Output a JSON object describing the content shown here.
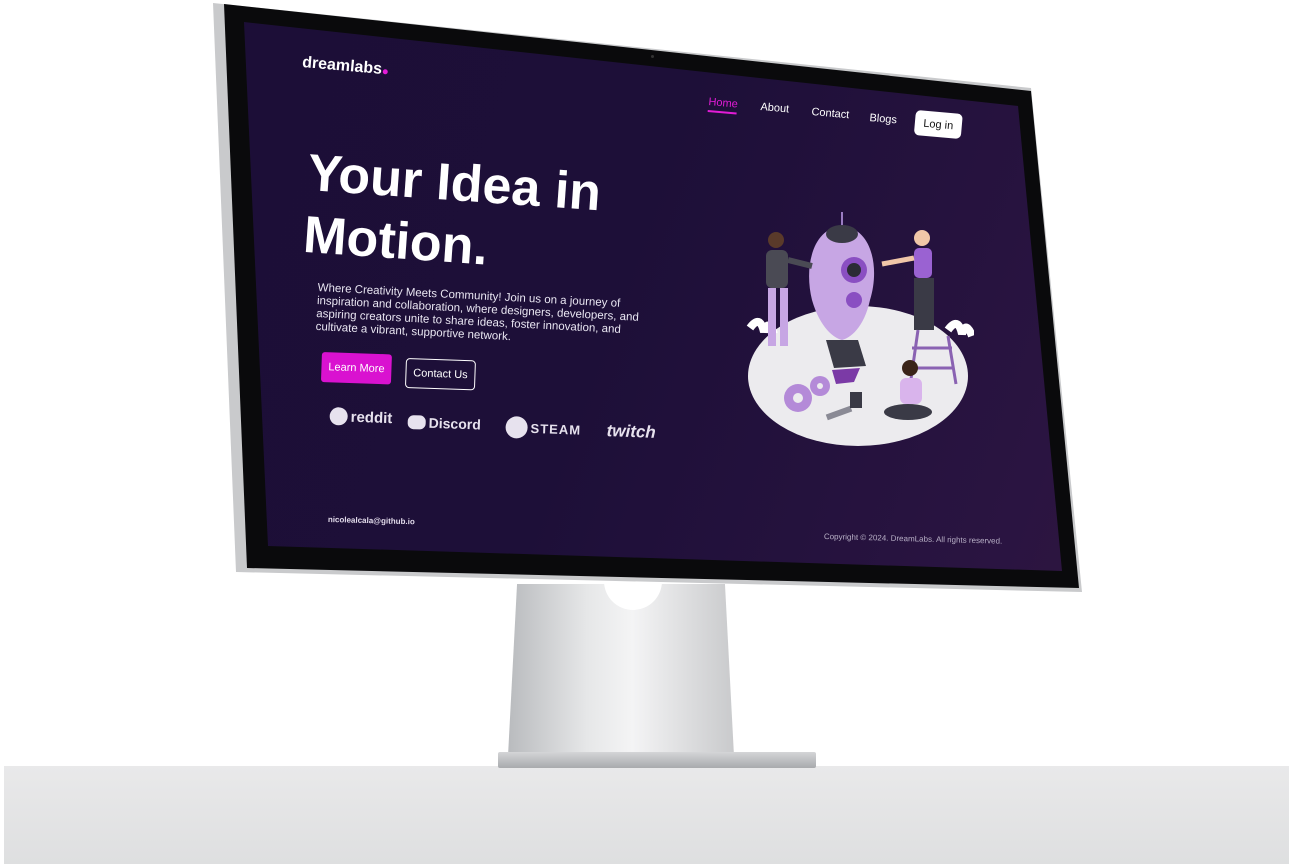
{
  "brand": {
    "name": "dreamlabs",
    "accent": "#d912d0"
  },
  "nav": {
    "items": [
      "Home",
      "About",
      "Contact",
      "Blogs"
    ],
    "active": "Home",
    "login_label": "Log in"
  },
  "hero": {
    "title_line1": "Your Idea in",
    "title_line2": "Motion.",
    "description": "Where Creativity Meets Community! Join us on a journey of inspiration and collaboration, where designers, developers, and aspiring creators unite to share ideas, foster innovation, and cultivate a vibrant, supportive network.",
    "primary_cta": "Learn More",
    "secondary_cta": "Contact Us"
  },
  "partners": [
    {
      "name": "reddit",
      "icon": "reddit-icon"
    },
    {
      "name": "Discord",
      "icon": "discord-icon"
    },
    {
      "name": "STEAM",
      "icon": "steam-icon"
    },
    {
      "name": "twitch",
      "icon": "twitch-icon"
    }
  ],
  "footer": {
    "contact": "nicolealcala@github.io",
    "copyright": "Copyright © 2024. DreamLabs. All rights reserved."
  },
  "colors": {
    "background_dark": "#1c0e36",
    "accent": "#d912d0",
    "text": "#ffffff"
  }
}
